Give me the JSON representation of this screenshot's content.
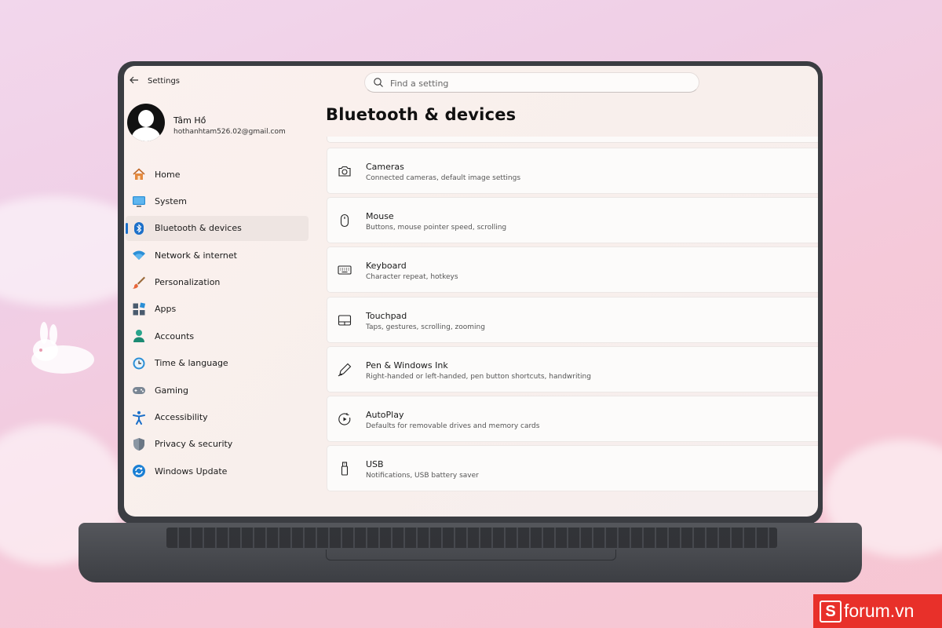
{
  "window": {
    "title": "Settings",
    "back_icon": "back-arrow-icon"
  },
  "search": {
    "placeholder": "Find a setting",
    "icon": "search-icon"
  },
  "profile": {
    "name": "Tâm Hồ",
    "email": "hothanhtam526.02@gmail.com"
  },
  "sidebar": {
    "items": [
      {
        "label": "Home",
        "icon": "home-icon",
        "active": false
      },
      {
        "label": "System",
        "icon": "system-icon",
        "active": false
      },
      {
        "label": "Bluetooth & devices",
        "icon": "bluetooth-icon",
        "active": true
      },
      {
        "label": "Network & internet",
        "icon": "wifi-icon",
        "active": false
      },
      {
        "label": "Personalization",
        "icon": "brush-icon",
        "active": false
      },
      {
        "label": "Apps",
        "icon": "apps-icon",
        "active": false
      },
      {
        "label": "Accounts",
        "icon": "accounts-icon",
        "active": false
      },
      {
        "label": "Time & language",
        "icon": "time-language-icon",
        "active": false
      },
      {
        "label": "Gaming",
        "icon": "gamepad-icon",
        "active": false
      },
      {
        "label": "Accessibility",
        "icon": "accessibility-icon",
        "active": false
      },
      {
        "label": "Privacy & security",
        "icon": "shield-icon",
        "active": false
      },
      {
        "label": "Windows Update",
        "icon": "update-icon",
        "active": false
      }
    ]
  },
  "main": {
    "title": "Bluetooth & devices",
    "cards": [
      {
        "title": "Cameras",
        "subtitle": "Connected cameras, default image settings",
        "icon": "camera-icon"
      },
      {
        "title": "Mouse",
        "subtitle": "Buttons, mouse pointer speed, scrolling",
        "icon": "mouse-icon"
      },
      {
        "title": "Keyboard",
        "subtitle": "Character repeat, hotkeys",
        "icon": "keyboard-icon"
      },
      {
        "title": "Touchpad",
        "subtitle": "Taps, gestures, scrolling, zooming",
        "icon": "touchpad-icon"
      },
      {
        "title": "Pen & Windows Ink",
        "subtitle": "Right-handed or left-handed, pen button shortcuts, handwriting",
        "icon": "pen-icon"
      },
      {
        "title": "AutoPlay",
        "subtitle": "Defaults for removable drives and memory cards",
        "icon": "autoplay-icon"
      },
      {
        "title": "USB",
        "subtitle": "Notifications, USB battery saver",
        "icon": "usb-icon"
      }
    ]
  },
  "colors": {
    "accent": "#1a6fc9",
    "background_pink": "#f2d7ec",
    "laptop_frame": "#3b3d42",
    "watermark_red": "#e8302a"
  },
  "watermark": {
    "letter": "S",
    "text": "forum.vn"
  }
}
